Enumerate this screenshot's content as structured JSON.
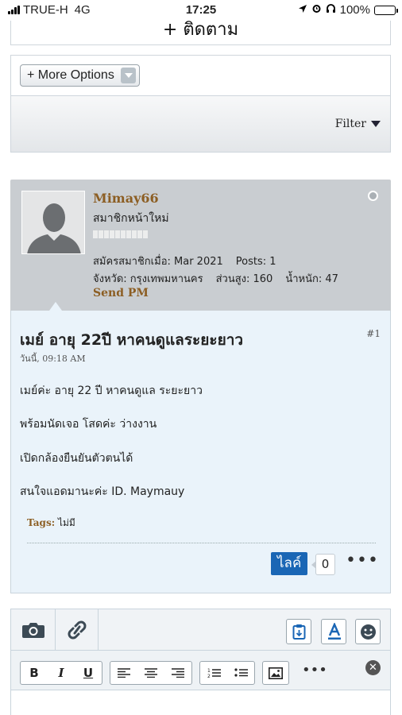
{
  "status": {
    "carrier": "TRUE-H",
    "network": "4G",
    "time": "17:25",
    "battery": "100%"
  },
  "follow": {
    "label": "+ ติดตาม"
  },
  "options": {
    "more_label": "+ More Options",
    "filter_label": "Filter"
  },
  "author": {
    "name": "Mimay66",
    "rank": "สมาชิกหน้าใหม่",
    "joined": "สมัครสมาชิกเมื่อ: Mar 2021",
    "posts": "Posts: 1",
    "province": "จังหวัด: กรุงเทพมหานคร",
    "height": "ส่วนสูง: 160",
    "weight": "น้ำหนัก: 47",
    "send_pm": "Send PM"
  },
  "post": {
    "title": "เมย์ อายุ 22ปี หาคนดูแลระยะยาว",
    "number": "#1",
    "date": "วันนี้, 09:18 AM",
    "lines": [
      "เมย์ค่ะ อายุ 22 ปี หาคนดูแล ระยะยาว",
      "พร้อมนัดเจอ โสดค่ะ ว่างงาน",
      "เปิดกล้องยืนยันตัวตนได้",
      "สนใจแอดมานะค่ะ ID. Maymauy"
    ],
    "tags_label": "Tags:",
    "tags_value": " ไม่มี",
    "like_label": "ไลค์",
    "like_count": "0",
    "more": "•••"
  },
  "editor": {
    "bold": "B",
    "italic": "I",
    "underline": "U",
    "more": "•••",
    "close": "✕",
    "icons": [
      "camera-icon",
      "link-icon",
      "clipboard-icon",
      "text-color-icon",
      "smiley-icon",
      "align-left-icon",
      "align-center-icon",
      "align-right-icon",
      "ordered-list-icon",
      "unordered-list-icon",
      "image-icon"
    ]
  },
  "colors": {
    "accent_brown": "#8c5e23",
    "like_blue": "#1a66b5",
    "post_bg": "#eaf3fa",
    "header_gray": "#c9cdd1"
  }
}
